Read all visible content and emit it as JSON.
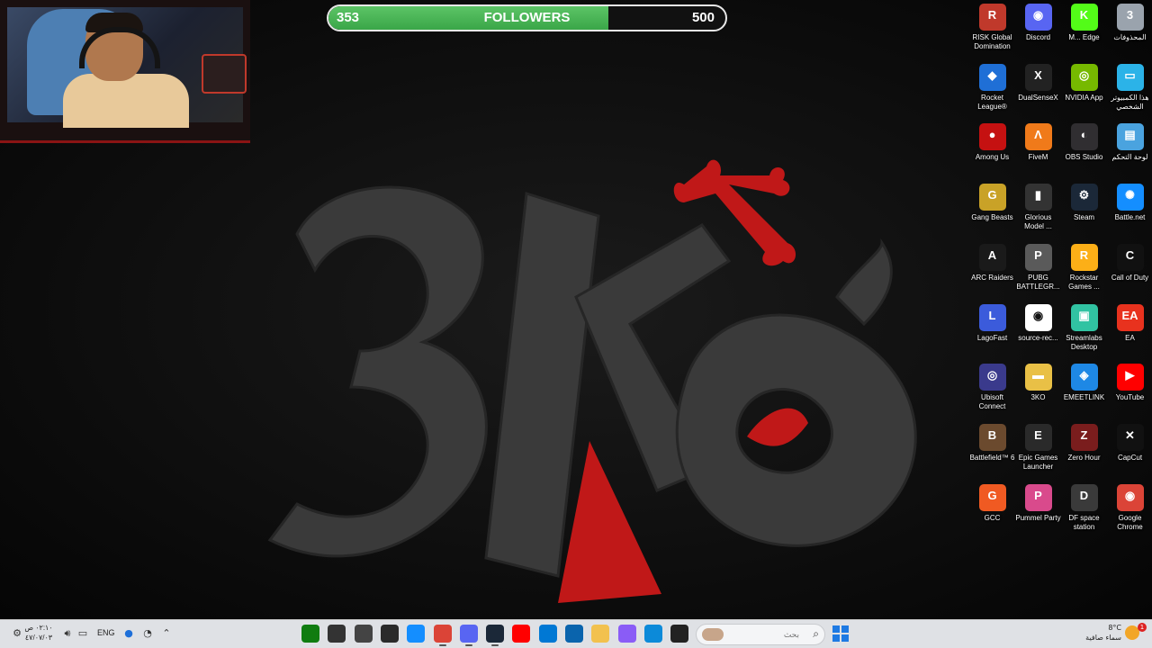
{
  "overlay": {
    "followers": {
      "current": "353",
      "title": "FOLLOWERS",
      "goal": "500",
      "progress": 0.706
    }
  },
  "desktop_icons": [
    {
      "label": "RISK Global Domination",
      "icon": "risk-icon",
      "color": "#c0392b",
      "glyph": "R"
    },
    {
      "label": "Discord",
      "icon": "discord-icon",
      "color": "#5865f2",
      "glyph": "◉"
    },
    {
      "label": "M... Edge",
      "icon": "kick-icon",
      "color": "#53fc18",
      "glyph": "K"
    },
    {
      "label": "المحذوفات",
      "icon": "recycle-bin-icon",
      "color": "#9aa3ad",
      "glyph": "3"
    },
    {
      "label": "Rocket League®",
      "icon": "rocket-league-icon",
      "color": "#1f6fd6",
      "glyph": "◆"
    },
    {
      "label": "DualSenseX",
      "icon": "dualsensex-icon",
      "color": "#222222",
      "glyph": "X"
    },
    {
      "label": "NVIDIA App",
      "icon": "nvidia-icon",
      "color": "#76b900",
      "glyph": "◎"
    },
    {
      "label": "هذا الكمبيوتر الشخصي",
      "icon": "this-pc-icon",
      "color": "#2bb3e8",
      "glyph": "▭"
    },
    {
      "label": "Among Us",
      "icon": "among-us-icon",
      "color": "#c51111",
      "glyph": "●"
    },
    {
      "label": "FiveM",
      "icon": "fivem-icon",
      "color": "#f07a1a",
      "glyph": "Λ"
    },
    {
      "label": "OBS Studio",
      "icon": "obs-icon",
      "color": "#302e31",
      "glyph": "◐"
    },
    {
      "label": "لوحة التحكم",
      "icon": "control-panel-icon",
      "color": "#4aa3df",
      "glyph": "▤"
    },
    {
      "label": "Gang Beasts",
      "icon": "gang-beasts-icon",
      "color": "#c9a227",
      "glyph": "G"
    },
    {
      "label": "Glorious Model ...",
      "icon": "glorious-mouse-icon",
      "color": "#333333",
      "glyph": "▮"
    },
    {
      "label": "Steam",
      "icon": "steam-icon",
      "color": "#1b2838",
      "glyph": "⚙"
    },
    {
      "label": "Battle.net",
      "icon": "battlenet-icon",
      "color": "#148eff",
      "glyph": "✺"
    },
    {
      "label": "ARC Raiders",
      "icon": "arc-raiders-icon",
      "color": "#1a1a1a",
      "glyph": "A"
    },
    {
      "label": "PUBG BATTLEGR...",
      "icon": "pubg-icon",
      "color": "#5a5a5a",
      "glyph": "P"
    },
    {
      "label": "Rockstar Games ...",
      "icon": "rockstar-icon",
      "color": "#fcaf17",
      "glyph": "R"
    },
    {
      "label": "Call of Duty",
      "icon": "call-of-duty-icon",
      "color": "#111111",
      "glyph": "C"
    },
    {
      "label": "LagoFast",
      "icon": "lagofast-icon",
      "color": "#3b5bdb",
      "glyph": "L"
    },
    {
      "label": "source-rec...",
      "icon": "source-record-icon",
      "color": "#ffffff",
      "glyph": "◉"
    },
    {
      "label": "Streamlabs Desktop",
      "icon": "streamlabs-icon",
      "color": "#31c3a2",
      "glyph": "▣"
    },
    {
      "label": "EA",
      "icon": "ea-icon",
      "color": "#e8321e",
      "glyph": "EA"
    },
    {
      "label": "Ubisoft Connect",
      "icon": "ubisoft-icon",
      "color": "#3a3a8c",
      "glyph": "◎"
    },
    {
      "label": "3KO",
      "icon": "folder-icon",
      "color": "#e9c046",
      "glyph": "▬"
    },
    {
      "label": "EMEETLINK",
      "icon": "emeetlink-icon",
      "color": "#1e88e5",
      "glyph": "◈"
    },
    {
      "label": "YouTube",
      "icon": "youtube-icon",
      "color": "#ff0000",
      "glyph": "▶"
    },
    {
      "label": "Battlefield™ 6",
      "icon": "battlefield-icon",
      "color": "#6b4a2e",
      "glyph": "B"
    },
    {
      "label": "Epic Games Launcher",
      "icon": "epic-games-icon",
      "color": "#2a2a2a",
      "glyph": "E"
    },
    {
      "label": "Zero Hour",
      "icon": "zero-hour-icon",
      "color": "#7a1d1d",
      "glyph": "Z"
    },
    {
      "label": "CapCut",
      "icon": "capcut-icon",
      "color": "#111111",
      "glyph": "✕"
    },
    {
      "label": "GCC",
      "icon": "gcc-icon",
      "color": "#f05a22",
      "glyph": "G"
    },
    {
      "label": "Pummel Party",
      "icon": "pummel-party-icon",
      "color": "#d94a8c",
      "glyph": "P"
    },
    {
      "label": "DF space station",
      "icon": "df-space-icon",
      "color": "#3a3a3a",
      "glyph": "D"
    },
    {
      "label": "Google Chrome",
      "icon": "chrome-icon",
      "color": "#db4437",
      "glyph": "◉"
    }
  ],
  "taskbar": {
    "clock_time": "٠٢:١٠ ص",
    "clock_date": "٤٧/٠٧/٠٣",
    "language": "ENG",
    "search_placeholder": "بحث",
    "weather_temp": "8°C",
    "weather_desc": "سماء صافية",
    "notification_count": "1",
    "pinned_apps": [
      {
        "name": "xbox-icon",
        "color": "#107c10"
      },
      {
        "name": "speedometer-icon",
        "color": "#333333"
      },
      {
        "name": "recording-icon",
        "color": "#444444"
      },
      {
        "name": "epic-games-icon",
        "color": "#2a2a2a"
      },
      {
        "name": "battlenet-icon",
        "color": "#148eff"
      },
      {
        "name": "chrome-icon",
        "color": "#db4437"
      },
      {
        "name": "discord-icon",
        "color": "#5865f2"
      },
      {
        "name": "steam-icon",
        "color": "#1b2838"
      },
      {
        "name": "youtube-icon",
        "color": "#ff0000"
      },
      {
        "name": "store-icon",
        "color": "#0078d4"
      },
      {
        "name": "outlook-icon",
        "color": "#0a64ad"
      },
      {
        "name": "file-explorer-icon",
        "color": "#f2c14e"
      },
      {
        "name": "copilot-icon",
        "color": "#8a5cf6"
      },
      {
        "name": "edge-icon",
        "color": "#0c8ad9"
      },
      {
        "name": "terminal-icon",
        "color": "#222222"
      }
    ]
  }
}
